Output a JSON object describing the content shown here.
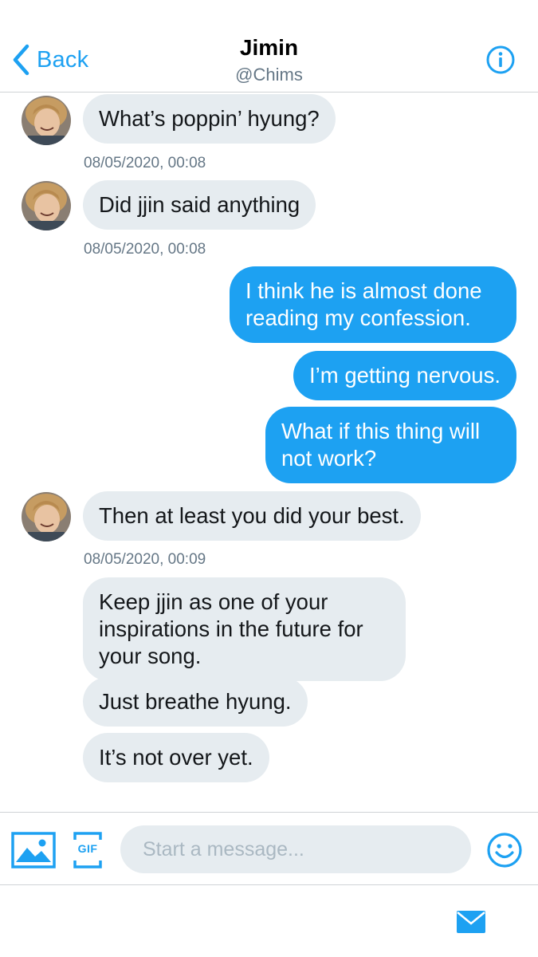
{
  "header": {
    "back_label": "Back",
    "title": "Jimin",
    "handle": "@Chims"
  },
  "messages": [
    {
      "side": "in",
      "text": "What’s poppin’ hyung?"
    },
    {
      "timestamp": "08/05/2020, 00:08"
    },
    {
      "side": "in",
      "text": "Did jjin said anything"
    },
    {
      "timestamp": "08/05/2020, 00:08"
    },
    {
      "side": "out",
      "text": "I think he is almost done reading my confession."
    },
    {
      "side": "out",
      "text": "I’m getting nervous."
    },
    {
      "side": "out",
      "text": "What if this thing will not work?"
    },
    {
      "side": "in",
      "text": "Then at least you did your best."
    },
    {
      "timestamp": "08/05/2020, 00:09"
    },
    {
      "side": "in",
      "text": "Keep jjin as one of your inspirations in the future for your song."
    },
    {
      "side": "in",
      "text": "Just breathe hyung."
    },
    {
      "side": "in",
      "text": "It’s not over yet."
    }
  ],
  "composer": {
    "placeholder": "Start a message...",
    "gif_label": "GIF"
  },
  "colors": {
    "accent": "#1da1f2",
    "incoming_bubble": "#e6ecf0",
    "outgoing_bubble": "#1da1f2",
    "secondary_text": "#657786"
  },
  "icons": {
    "back": "chevron-left-icon",
    "info": "info-icon",
    "media": "image-icon",
    "gif": "gif-icon",
    "emoji": "smiley-icon",
    "mail": "envelope-icon"
  }
}
